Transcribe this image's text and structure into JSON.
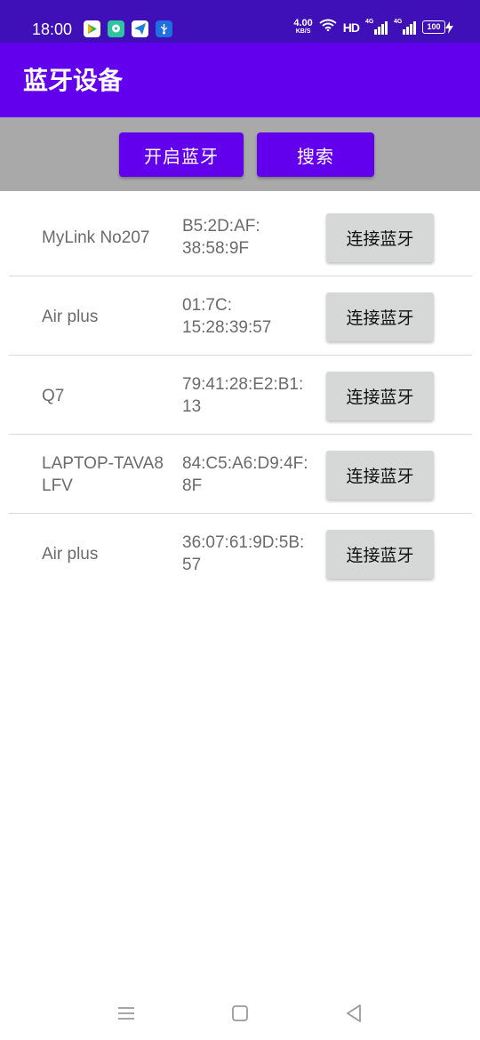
{
  "status_bar": {
    "time": "18:00",
    "net_speed_value": "4.00",
    "net_speed_unit": "KB/S",
    "hd_label": "HD",
    "signal_1_label": "4G",
    "signal_2_label": "4G",
    "battery_level": "100",
    "app_icons": [
      "play-store-icon",
      "chat-icon",
      "telegram-icon",
      "usb-icon"
    ]
  },
  "app_bar": {
    "title": "蓝牙设备"
  },
  "toolbar": {
    "enable_bluetooth_label": "开启蓝牙",
    "search_label": "搜索"
  },
  "devices": [
    {
      "name": "MyLink No207",
      "mac": "B5:2D:AF:\n38:58:9F",
      "action": "连接蓝牙"
    },
    {
      "name": "Air plus",
      "mac": "01:7C:\n15:28:39:57",
      "action": "连接蓝牙"
    },
    {
      "name": "Q7",
      "mac": "79:41:28:E2:B1:\n13",
      "action": "连接蓝牙"
    },
    {
      "name": "LAPTOP-TAVA8\nLFV",
      "mac": "84:C5:A6:D9:4F:\n8F",
      "action": "连接蓝牙"
    },
    {
      "name": "Air plus",
      "mac": "36:07:61:9D:5B:\n57",
      "action": "连接蓝牙"
    }
  ],
  "colors": {
    "status_bar": "#3f0fb8",
    "primary": "#6200ee",
    "toolbar_bg": "#a9a9a9",
    "connect_button_bg": "#d6d7d7",
    "list_text": "#6b6b6b"
  },
  "nav_bar": {
    "icons": [
      "menu-icon",
      "home-icon",
      "back-icon"
    ]
  }
}
